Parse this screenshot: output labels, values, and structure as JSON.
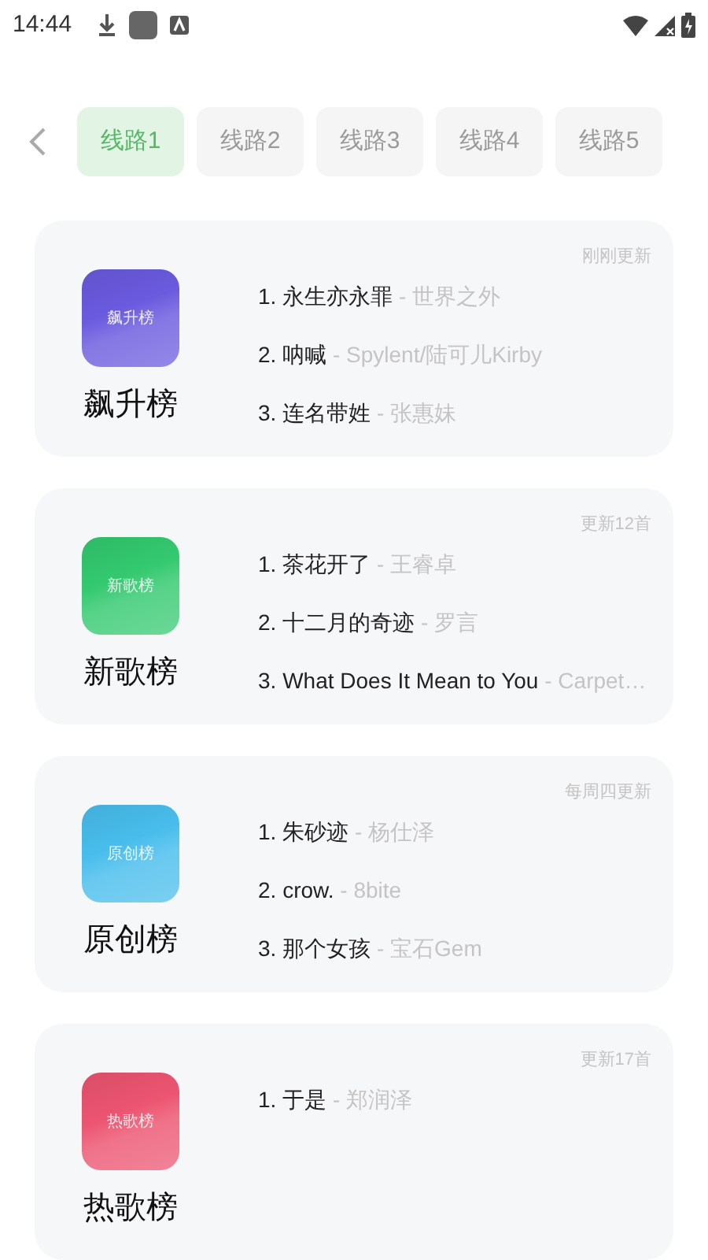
{
  "status_bar": {
    "time": "14:44"
  },
  "tabs": [
    {
      "label": "线路1",
      "selected": true
    },
    {
      "label": "线路2",
      "selected": false
    },
    {
      "label": "线路3",
      "selected": false
    },
    {
      "label": "线路4",
      "selected": false
    },
    {
      "label": "线路5",
      "selected": false
    }
  ],
  "charts": [
    {
      "name": "飙升榜",
      "cover_label": "飙升榜",
      "color": "#6a5ade",
      "update": "刚刚更新",
      "songs": [
        {
          "title": "1. 永生亦永罪",
          "artist": "- 世界之外"
        },
        {
          "title": "2. 呐喊",
          "artist": "- Spylent/陆可儿Kirby"
        },
        {
          "title": "3. 连名带姓",
          "artist": "- 张惠妹"
        }
      ]
    },
    {
      "name": "新歌榜",
      "cover_label": "新歌榜",
      "color": "#33c96f",
      "update": "更新12首",
      "songs": [
        {
          "title": "1. 茶花开了",
          "artist": "- 王睿卓"
        },
        {
          "title": "2. 十二月的奇迹",
          "artist": "- 罗言"
        },
        {
          "title": "3. What Does It Mean to You",
          "artist": "- Carpet…"
        }
      ]
    },
    {
      "name": "原创榜",
      "cover_label": "原创榜",
      "color": "#48bdec",
      "update": "每周四更新",
      "songs": [
        {
          "title": "1. 朱砂迹",
          "artist": "- 杨仕泽"
        },
        {
          "title": "2. crow.",
          "artist": "- 8bite"
        },
        {
          "title": "3. 那个女孩",
          "artist": "- 宝石Gem"
        }
      ]
    },
    {
      "name": "热歌榜",
      "cover_label": "热歌榜",
      "color": "#ec5470",
      "update": "更新17首",
      "songs": [
        {
          "title": "1. 于是",
          "artist": "- 郑润泽"
        }
      ]
    }
  ]
}
